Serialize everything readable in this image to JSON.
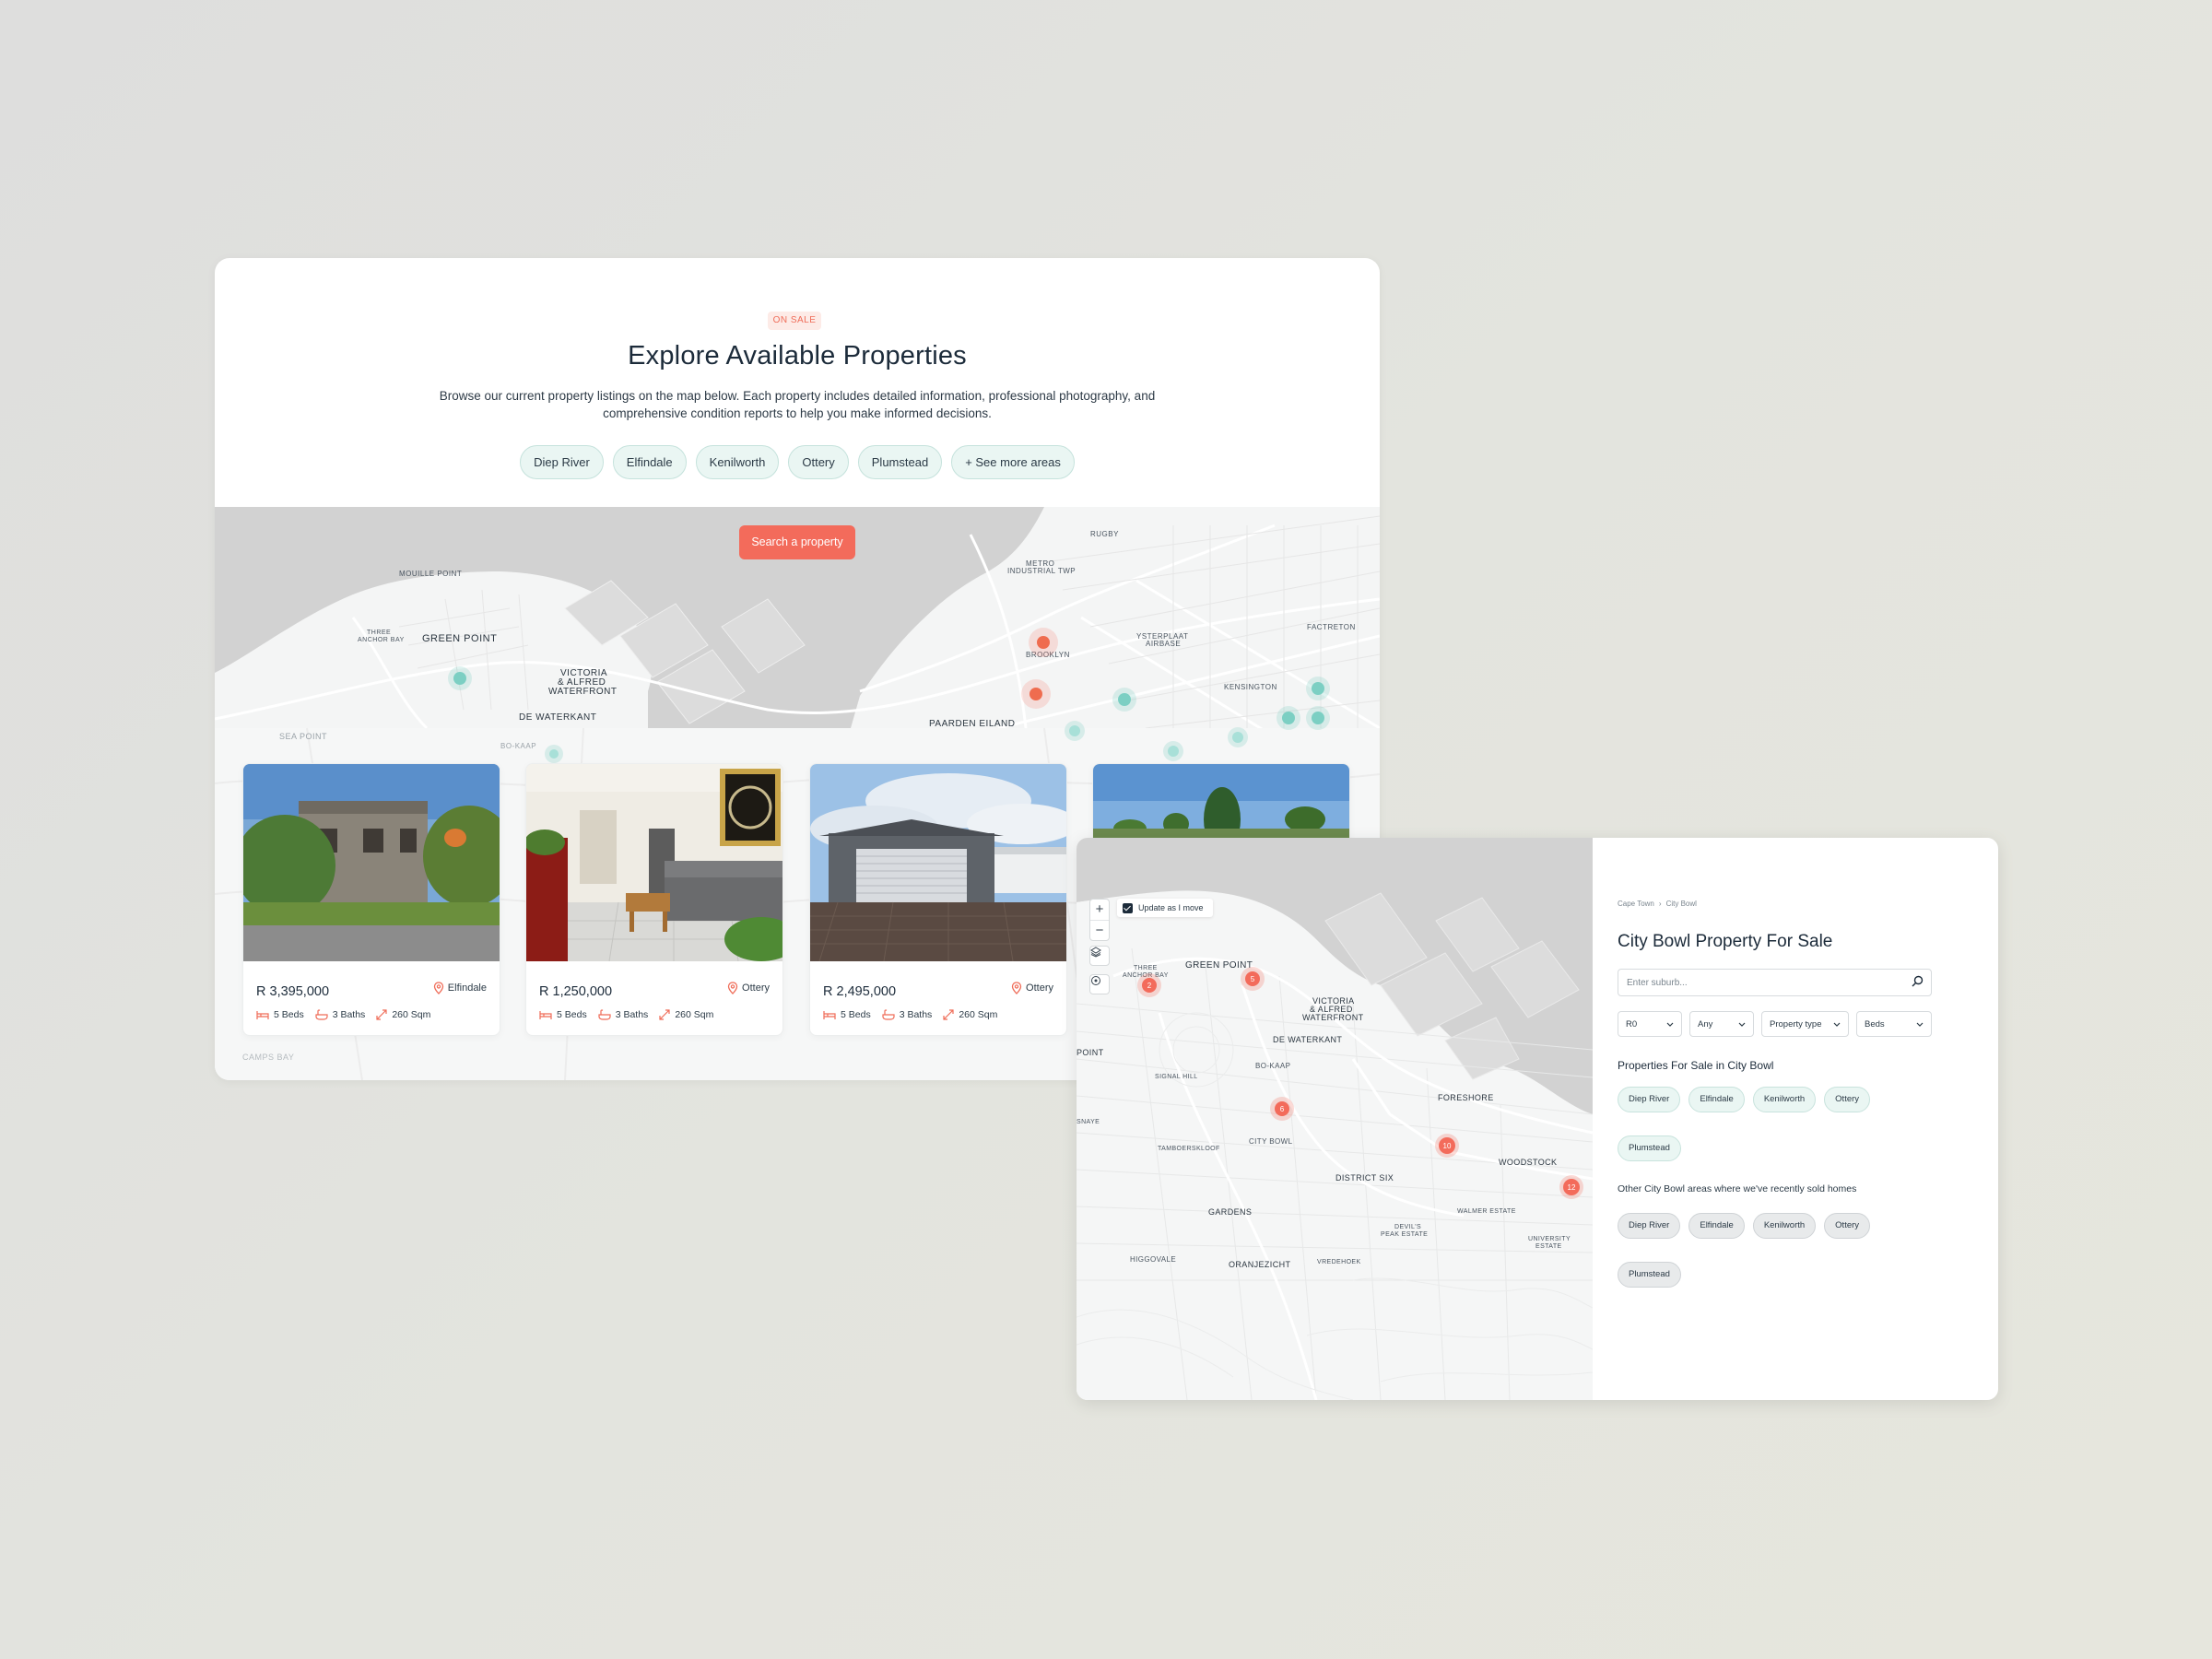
{
  "listing_page": {
    "badge": "ON SALE",
    "title": "Explore Available Properties",
    "description": "Browse our current property listings on the map below. Each property includes detailed information, professional photography, and comprehensive condition reports to help you make informed decisions.",
    "area_chips": [
      "Diep River",
      "Elfindale",
      "Kenilworth",
      "Ottery",
      "Plumstead",
      "+ See more areas"
    ],
    "search_button": "Search a property",
    "map_labels": [
      "MOUILLE POINT",
      "THREE ANCHOR BAY",
      "GREEN POINT",
      "VICTORIA & ALFRED WATERFRONT",
      "DE WATERKANT",
      "SEA POINT",
      "BO-KAAP",
      "RUGBY",
      "METRO INDUSTRIAL TWP",
      "BROOKLYN",
      "YSTERPLAAT AIRBASE",
      "FACTRETON",
      "KENSINGTON",
      "PAARDEN EILAND",
      "CAMPS BAY"
    ],
    "properties": [
      {
        "price": "R 3,395,000",
        "location": "Elfindale",
        "beds": "5 Beds",
        "baths": "3 Baths",
        "size": "260 Sqm"
      },
      {
        "price": "R 1,250,000",
        "location": "Ottery",
        "beds": "5 Beds",
        "baths": "3 Baths",
        "size": "260 Sqm"
      },
      {
        "price": "R 2,495,000",
        "location": "Ottery",
        "beds": "5 Beds",
        "baths": "3 Baths",
        "size": "260 Sqm"
      }
    ]
  },
  "city_bowl_page": {
    "breadcrumb": [
      "Cape Town",
      "City Bowl"
    ],
    "title": "City Bowl Property For Sale",
    "search_placeholder": "Enter suburb...",
    "filters": [
      "R0",
      "Any",
      "Property type",
      "Beds"
    ],
    "section_title": "Properties For Sale in City Bowl",
    "area_chips": [
      "Diep River",
      "Elfindale",
      "Kenilworth",
      "Ottery",
      "Plumstead"
    ],
    "recent_title": "Other City Bowl areas where we've recently sold homes",
    "recent_chips": [
      "Diep River",
      "Elfindale",
      "Kenilworth",
      "Ottery",
      "Plumstead"
    ],
    "map": {
      "update_toggle": "Update as I move",
      "update_checked": true,
      "zoom_in": "+",
      "zoom_out": "−",
      "clusters": [
        "2",
        "5",
        "6",
        "10",
        "12"
      ],
      "labels": [
        "THREE ANCHOR BAY",
        "GREEN POINT",
        "VICTORIA & ALFRED WATERFRONT",
        "POINT",
        "DE WATERKANT",
        "BO-KAAP",
        "SIGNAL HILL",
        "FORESHORE",
        "CITY BOWL",
        "TAMBOERSKLOOF",
        "DISTRICT SIX",
        "WOODSTOCK",
        "GARDENS",
        "WALMER ESTATE",
        "DEVIL'S PEAK ESTATE",
        "UNIVERSITY ESTATE",
        "HIGGOVALE",
        "ORANJEZICHT",
        "VREDEHOEK",
        "SNAYE"
      ]
    }
  },
  "colors": {
    "accent": "#f36b5b",
    "teal": "#5fc4b4",
    "chip_bg": "#eaf6f3",
    "text": "#1c2b3a"
  }
}
